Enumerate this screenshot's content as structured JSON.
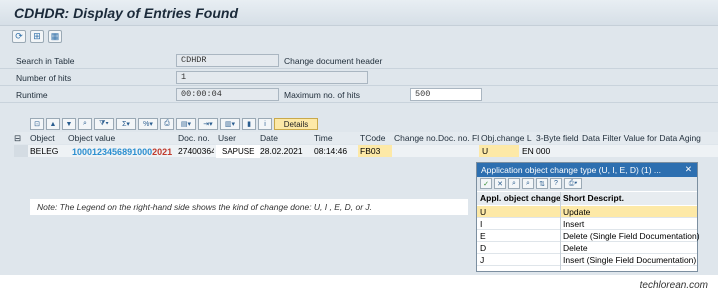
{
  "window": {
    "title": "CDHDR: Display of Entries Found"
  },
  "toolbar": {
    "icons": [
      "refresh-icon",
      "filter-icon",
      "table-icon"
    ]
  },
  "form": {
    "search_label": "Search in Table",
    "search_value": "CDHDR",
    "search_desc": "Change document header",
    "hits_label": "Number of hits",
    "hits_value": "1",
    "runtime_label": "Runtime",
    "runtime_value": "00:00:04",
    "maxhits_label": "Maximum no. of hits",
    "maxhits_value": "500"
  },
  "alv_toolbar": {
    "details_label": "Details"
  },
  "grid": {
    "headers": [
      "Object",
      "Object value",
      "Doc. no.",
      "User",
      "Date",
      "Time",
      "TCode",
      "Change no.",
      "Doc. no. Fl",
      "Obj.change L",
      "3-Byte field",
      "Data Filter Value for Data Aging"
    ],
    "row": {
      "object": "BELEG",
      "value_a": "1000",
      "value_b": "123456891000",
      "value_c": "2021",
      "doc_no": "27400364",
      "user": "SAPUSE",
      "date": "28.02.2021",
      "time": "08:14:46",
      "tcode": "FB03",
      "objchange": "U",
      "lang": "EN",
      "byte3": "000"
    }
  },
  "note": "Note: The Legend on the right-hand side shows the kind of change done: U, I , E, D, or J.",
  "popup": {
    "title": "Application object change type (U, I, E, D) (1) ...",
    "col_code": "Appl. object change",
    "col_desc": "Short Descript.",
    "rows": [
      {
        "code": "U",
        "desc": "Update"
      },
      {
        "code": "I",
        "desc": "Insert"
      },
      {
        "code": "E",
        "desc": "Delete (Single Field Documentation)"
      },
      {
        "code": "D",
        "desc": "Delete"
      },
      {
        "code": "J",
        "desc": "Insert (Single Field Documentation)"
      }
    ]
  },
  "watermark": "techlorean.com",
  "colors": {
    "accent": "#2d6fb0",
    "highlight": "#fde9a7",
    "value_blue": "#2b8fd0",
    "value_red": "#c0392b"
  }
}
